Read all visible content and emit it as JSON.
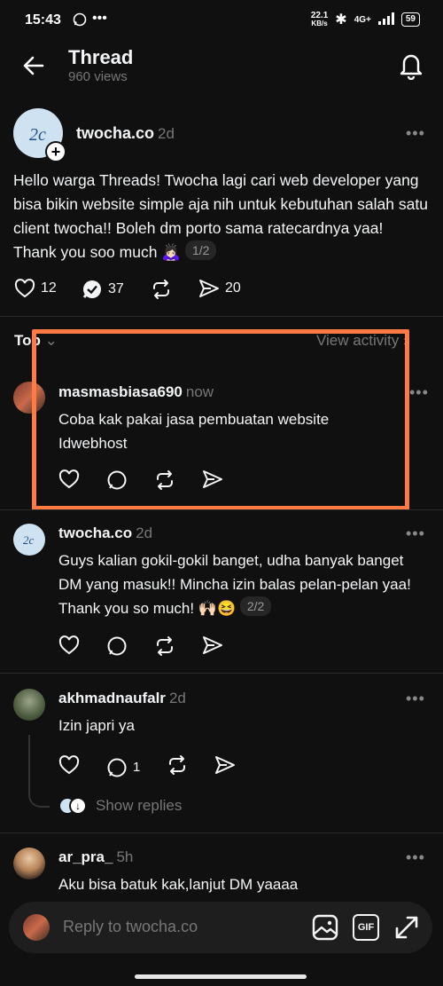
{
  "status_bar": {
    "time": "15:43",
    "net_speed": "22.1",
    "net_unit": "KB/s",
    "signal": "4G+",
    "battery": "59"
  },
  "header": {
    "title": "Thread",
    "views": "960 views"
  },
  "main_post": {
    "username": "twocha.co",
    "time": "2d",
    "text": "Hello warga Threads! Twocha lagi cari web developer yang bisa bikin website simple aja nih untuk kebutuhan salah satu client twocha!! Boleh dm porto sama ratecardnya yaa! Thank you soo much 🙇🏻‍♀️",
    "page": "1/2",
    "likes": "12",
    "comments": "37",
    "shares": "20"
  },
  "sort": {
    "label": "Top",
    "view_activity": "View activity"
  },
  "replies": [
    {
      "username": "masmasbiasa690",
      "time": "now",
      "text": "Coba kak pakai jasa pembuatan website Idwebhost"
    },
    {
      "username": "twocha.co",
      "time": "2d",
      "text": "Guys kalian gokil-gokil banget, udha banyak banget DM yang masuk!! Mincha izin balas pelan-pelan yaa! Thank you so much! 🙌🏻😆",
      "page": "2/2"
    },
    {
      "username": "akhmadnaufalr",
      "time": "2d",
      "text": "Izin japri ya",
      "comments": "1",
      "show_replies": "Show replies"
    },
    {
      "username": "ar_pra_",
      "time": "5h",
      "text": "Aku bisa batuk kak,lanjut DM yaaaa"
    }
  ],
  "reply_bar": {
    "placeholder": "Reply to twocha.co",
    "gif": "GIF"
  },
  "colors": {
    "background": "#101010",
    "highlight": "#ff7a45",
    "muted": "#777777",
    "verified": "#f3f5f7"
  }
}
